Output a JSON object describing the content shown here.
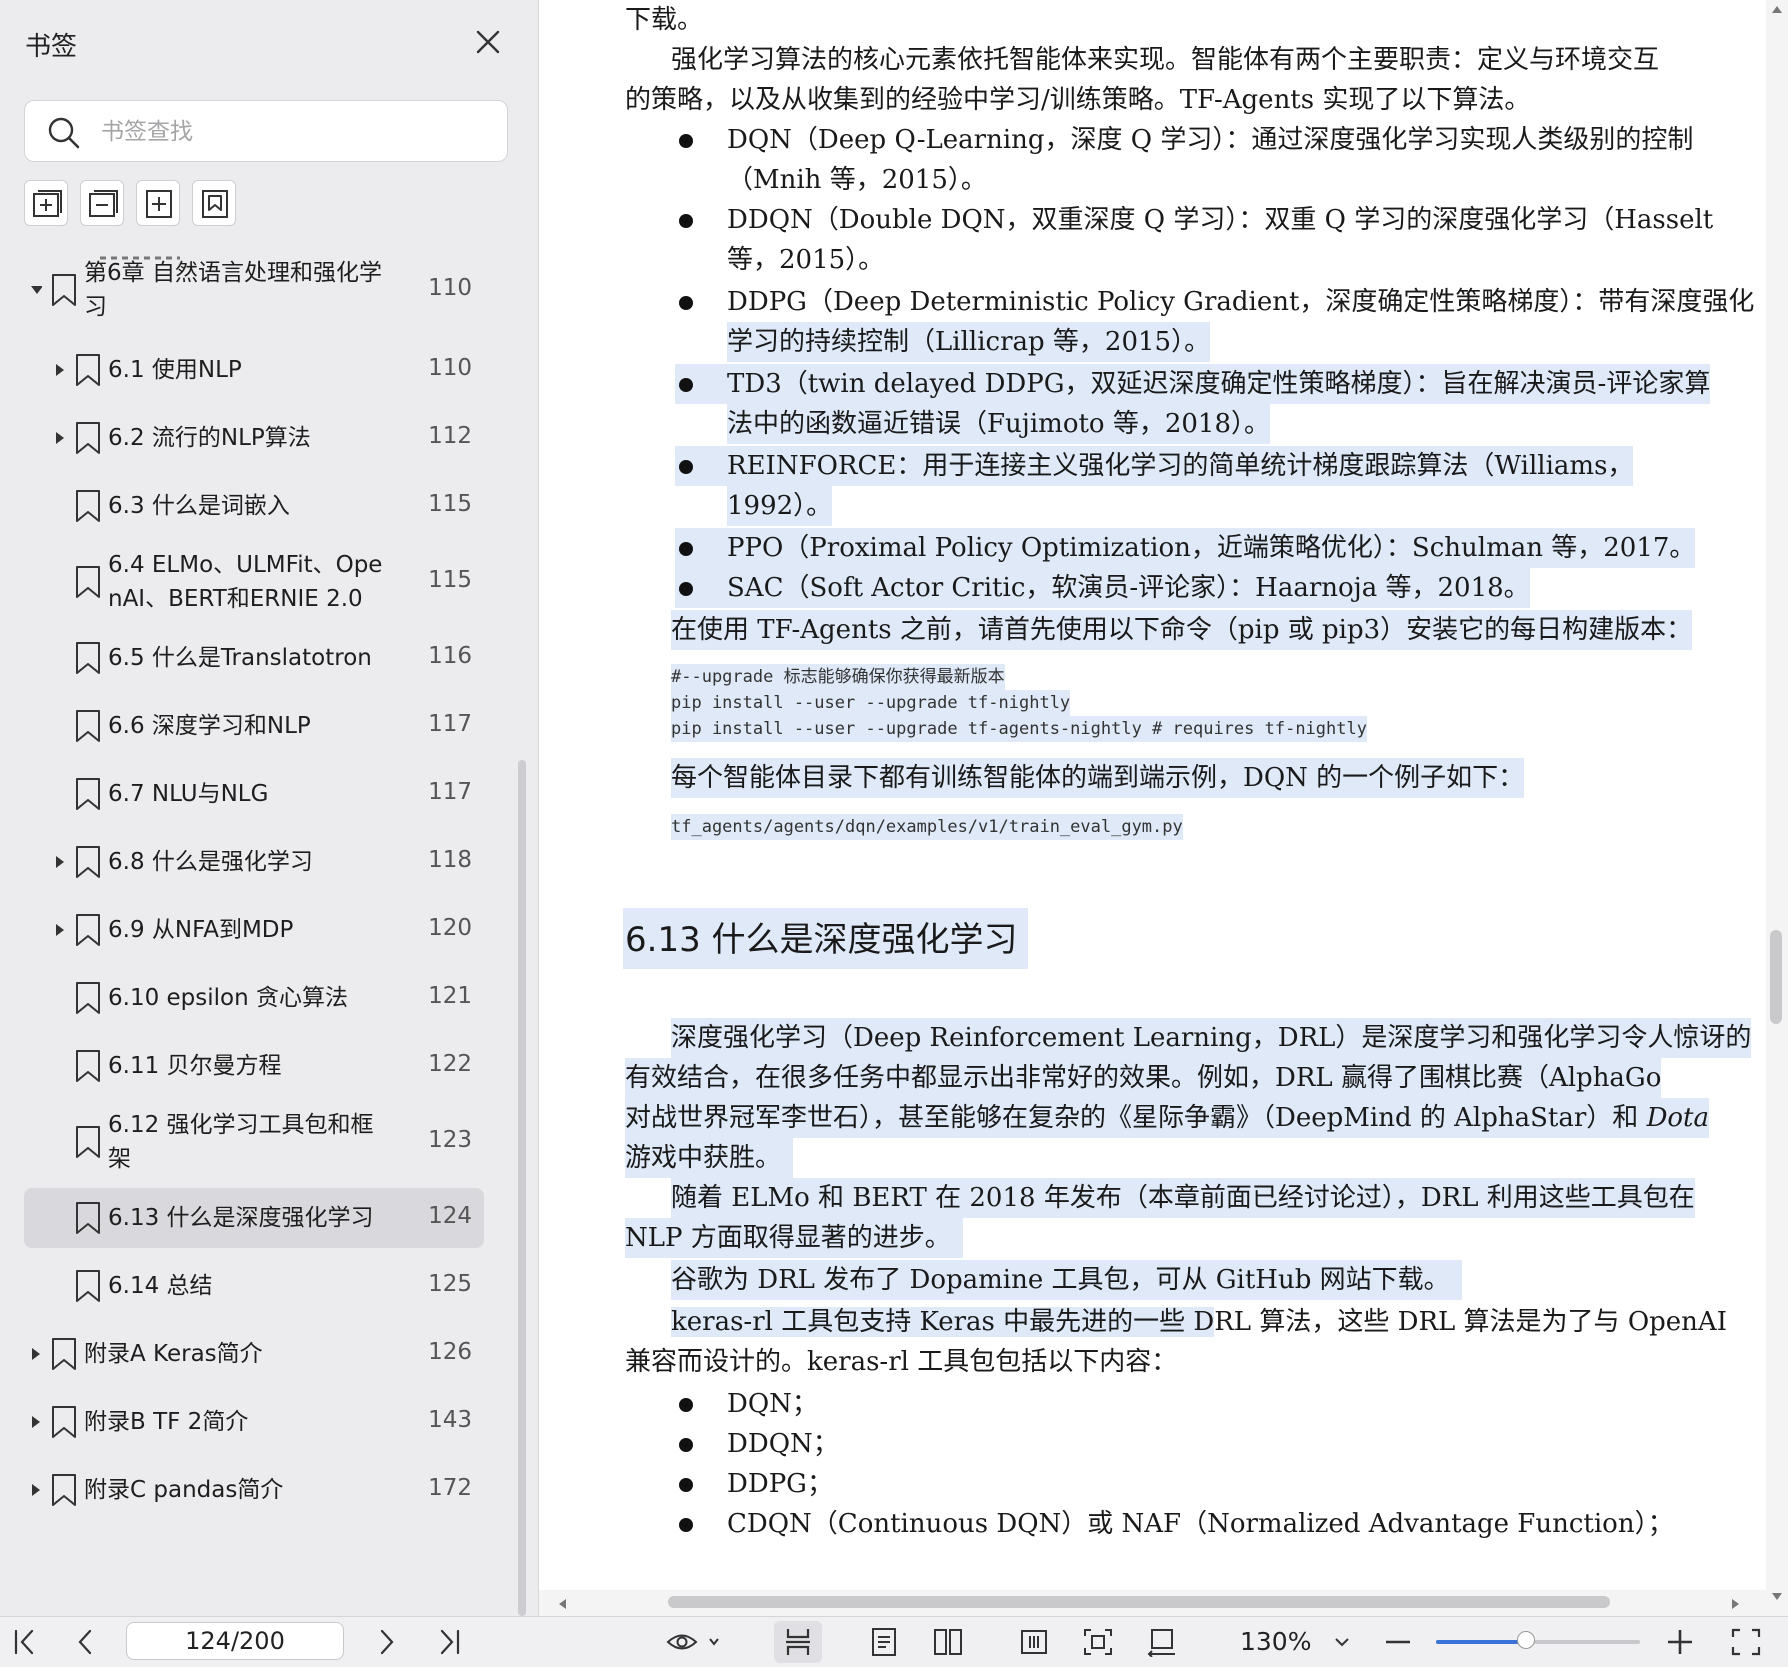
{
  "sidebar": {
    "title": "书签",
    "search_placeholder": "书签查找",
    "items": [
      {
        "label_lines": [
          "第6章  自然语言处理和强化学",
          "习"
        ],
        "page": "110",
        "level": 0,
        "expandable": true,
        "expanded": true
      },
      {
        "label_lines": [
          "6.1  使用NLP"
        ],
        "page": "110",
        "level": 1,
        "expandable": true
      },
      {
        "label_lines": [
          "6.2  流行的NLP算法"
        ],
        "page": "112",
        "level": 1,
        "expandable": true
      },
      {
        "label_lines": [
          "6.3  什么是词嵌入"
        ],
        "page": "115",
        "level": 1,
        "expandable": false
      },
      {
        "label_lines": [
          "6.4  ELMo、ULMFit、Ope",
          "nAI、BERT和ERNIE 2.0"
        ],
        "page": "115",
        "level": 1,
        "expandable": false
      },
      {
        "label_lines": [
          "6.5  什么是Translatotron"
        ],
        "page": "116",
        "level": 1,
        "expandable": false
      },
      {
        "label_lines": [
          "6.6  深度学习和NLP"
        ],
        "page": "117",
        "level": 1,
        "expandable": false
      },
      {
        "label_lines": [
          "6.7  NLU与NLG"
        ],
        "page": "117",
        "level": 1,
        "expandable": false
      },
      {
        "label_lines": [
          "6.8  什么是强化学习"
        ],
        "page": "118",
        "level": 1,
        "expandable": true
      },
      {
        "label_lines": [
          "6.9  从NFA到MDP"
        ],
        "page": "120",
        "level": 1,
        "expandable": true
      },
      {
        "label_lines": [
          "6.10  epsilon 贪心算法"
        ],
        "page": "121",
        "level": 1,
        "expandable": false
      },
      {
        "label_lines": [
          "6.11  贝尔曼方程"
        ],
        "page": "122",
        "level": 1,
        "expandable": false
      },
      {
        "label_lines": [
          "6.12  强化学习工具包和框",
          "架"
        ],
        "page": "123",
        "level": 1,
        "expandable": false
      },
      {
        "label_lines": [
          "6.13  什么是深度强化学习"
        ],
        "page": "124",
        "level": 1,
        "expandable": false,
        "active": true
      },
      {
        "label_lines": [
          "6.14  总结"
        ],
        "page": "125",
        "level": 1,
        "expandable": false
      },
      {
        "label_lines": [
          "附录A  Keras简介"
        ],
        "page": "126",
        "level": 0,
        "expandable": true
      },
      {
        "label_lines": [
          "附录B  TF 2简介"
        ],
        "page": "143",
        "level": 0,
        "expandable": true
      },
      {
        "label_lines": [
          "附录C  pandas简介"
        ],
        "page": "172",
        "level": 0,
        "expandable": true
      }
    ]
  },
  "document": {
    "lines": {
      "l0": "下载。",
      "l1": "强化学习算法的核心元素依托智能体来实现。智能体有两个主要职责：定义与环境交互",
      "l2": "的策略，以及从收集到的经验中学习/训练策略。TF-Agents 实现了以下算法。",
      "b1a": "DQN（Deep Q-Learning，深度 Q 学习）：通过深度强化学习实现人类级别的控制",
      "b1b": "（Mnih 等，2015）。",
      "b2a": "DDQN（Double DQN，双重深度 Q 学习）：双重 Q 学习的深度强化学习（Hasselt",
      "b2b": "等，2015）。",
      "b3a": "DDPG（Deep Deterministic Policy Gradient，深度确定性策略梯度）：带有深度强化",
      "b3b": "学习的持续控制（Lillicrap 等，2015）。",
      "b4a": "TD3（twin delayed DDPG，双延迟深度确定性策略梯度）：旨在解决演员-评论家算",
      "b4b": "法中的函数逼近错误（Fujimoto 等，2018）。",
      "b5a": "REINFORCE：用于连接主义强化学习的简单统计梯度跟踪算法（Williams，",
      "b5b": "1992）。",
      "b6": "PPO（Proximal Policy Optimization，近端策略优化）：Schulman 等，2017。",
      "b7": "SAC（Soft Actor Critic，软演员-评论家）：Haarnoja 等，2018。",
      "p3": "在使用 TF-Agents 之前，请首先使用以下命令（pip 或 pip3）安装它的每日构建版本：",
      "c1": "#--upgrade 标志能够确保你获得最新版本",
      "c2": "pip install --user --upgrade tf-nightly",
      "c3": "pip install --user --upgrade tf-agents-nightly # requires tf-nightly",
      "p4": "每个智能体目录下都有训练智能体的端到端示例，DQN 的一个例子如下：",
      "c4": "tf_agents/agents/dqn/examples/v1/train_eval_gym.py",
      "h1": "6.13   什么是深度强化学习",
      "p5a": "深度强化学习（Deep Reinforcement Learning，DRL）是深度学习和强化学习令人惊讶的",
      "p5b": "有效结合，在很多任务中都显示出非常好的效果。例如，DRL 赢得了围棋比赛（AlphaGo",
      "p5c_pre": "对战世界冠军李世石），甚至能够在复杂的《星际争霸》（DeepMind 的 AlphaStar）和 ",
      "p5c_em": "Dota",
      "p5d": "游戏中获胜。",
      "p6a": "随着 ELMo 和 BERT 在 2018 年发布（本章前面已经讨论过），DRL 利用这些工具包在",
      "p6b": "NLP 方面取得显著的进步。",
      "p7": "谷歌为 DRL 发布了 Dopamine 工具包，可从 GitHub 网站下载。",
      "p8a_hl": "keras-rl 工具包支持 Keras 中最先进的一些 D",
      "p8a_rest": "RL 算法，这些 DRL 算法是为了与 OpenAI",
      "p8b": "兼容而设计的。keras-rl 工具包包括以下内容：",
      "k1": "DQN；",
      "k2": "DDQN；",
      "k3": "DDPG；",
      "k4": "CDQN（Continuous DQN）或 NAF（Normalized Advantage Function）；"
    }
  },
  "toolbar": {
    "page_value": "124/200",
    "zoom": "130%",
    "zoom_fraction": 0.44,
    "accent_color": "#3b73d9"
  }
}
